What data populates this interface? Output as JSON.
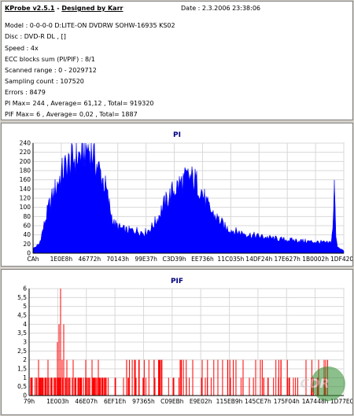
{
  "header": {
    "app_title": "KProbe v2.5.1 - Designed by Karr",
    "app_name": "KProbe v2.5.1",
    "app_designer": "Designed by Karr",
    "date": "Date : 2.3.2006 23:38:06"
  },
  "info_lines": [
    "Model : 0-0-0-0 D:LITE-ON DVDRW SOHW-16935 KS02",
    "Disc : DVD-R DL ,  []",
    "Speed : 4x",
    "ECC blocks sum (PI/PIF) : 8/1",
    "Scanned range : 0 - 2029712",
    "Sampling count : 107520",
    "Errors : 8479",
    "PI Max= 244 , Average= 61,12 , Total= 919320",
    "PIF Max= 6 , Average= 0,02 , Total= 1887"
  ],
  "watermark": "CDR",
  "chart_data": [
    {
      "type": "area",
      "title": "PI",
      "color": "#0000ff",
      "ylim": [
        0,
        240
      ],
      "y_ticks": [
        "0",
        "20",
        "40",
        "60",
        "80",
        "100",
        "120",
        "140",
        "160",
        "180",
        "200",
        "220",
        "240"
      ],
      "x_ticks": [
        "CAh",
        "1E0E8h",
        "46772h",
        "70143h",
        "99E37h",
        "C3D39h",
        "EE736h",
        "11C035h",
        "14DF24h",
        "17E627h",
        "1B0002h",
        "1DF420h"
      ],
      "grid": true,
      "profile_x": [
        0.0,
        0.02,
        0.05,
        0.08,
        0.1,
        0.13,
        0.155,
        0.175,
        0.19,
        0.2,
        0.22,
        0.235,
        0.25,
        0.26,
        0.28,
        0.3,
        0.33,
        0.36,
        0.38,
        0.4,
        0.42,
        0.45,
        0.47,
        0.5,
        0.52,
        0.54,
        0.56,
        0.58,
        0.6,
        0.62,
        0.65,
        0.7,
        0.75,
        0.8,
        0.85,
        0.9,
        0.93,
        0.95,
        0.96,
        0.965,
        0.97,
        0.975,
        0.98,
        1.0
      ],
      "profile_y": [
        10,
        20,
        100,
        155,
        185,
        205,
        215,
        230,
        220,
        200,
        170,
        140,
        90,
        65,
        55,
        50,
        50,
        45,
        55,
        75,
        105,
        135,
        150,
        165,
        160,
        140,
        105,
        85,
        72,
        55,
        48,
        40,
        35,
        30,
        28,
        25,
        24,
        22,
        25,
        60,
        150,
        30,
        15,
        5
      ]
    },
    {
      "type": "bar",
      "title": "PIF",
      "color": "#ff0000",
      "ylim": [
        0,
        6
      ],
      "y_ticks": [
        "0",
        "0,5",
        "1",
        "1,5",
        "2",
        "2,5",
        "3",
        "3,5",
        "4",
        "4,5",
        "5",
        "5,5",
        "6"
      ],
      "x_ticks": [
        "79h",
        "1E003h",
        "46E07h",
        "6EF1Eh",
        "97365h",
        "C09EBh",
        "E9E02h",
        "115EB9h",
        "145CE7h",
        "175F04h",
        "1A7448h",
        "1D77E0h"
      ],
      "grid": true,
      "spikes_x": [
        0.01,
        0.03,
        0.05,
        0.06,
        0.08,
        0.09,
        0.095,
        0.1,
        0.105,
        0.11,
        0.115,
        0.12,
        0.13,
        0.14,
        0.16,
        0.18,
        0.19,
        0.2,
        0.21,
        0.22,
        0.24,
        0.3,
        0.31,
        0.34,
        0.35,
        0.4,
        0.42,
        0.46,
        0.48,
        0.5,
        0.52,
        0.56,
        0.6,
        0.64,
        0.68,
        0.7,
        0.72,
        0.76,
        0.8,
        0.84,
        0.88,
        0.9,
        0.92,
        0.94
      ],
      "spikes_y": [
        1,
        2,
        1,
        2,
        1,
        3,
        4,
        6,
        2,
        4,
        1,
        2,
        1,
        2,
        1,
        2,
        1,
        2,
        1,
        2,
        1,
        1,
        2,
        1,
        2,
        1,
        2,
        1,
        2,
        1,
        2,
        1,
        2,
        1,
        2,
        1,
        2,
        1,
        2,
        1,
        2,
        1,
        2,
        1
      ],
      "floor_level": 1
    }
  ]
}
